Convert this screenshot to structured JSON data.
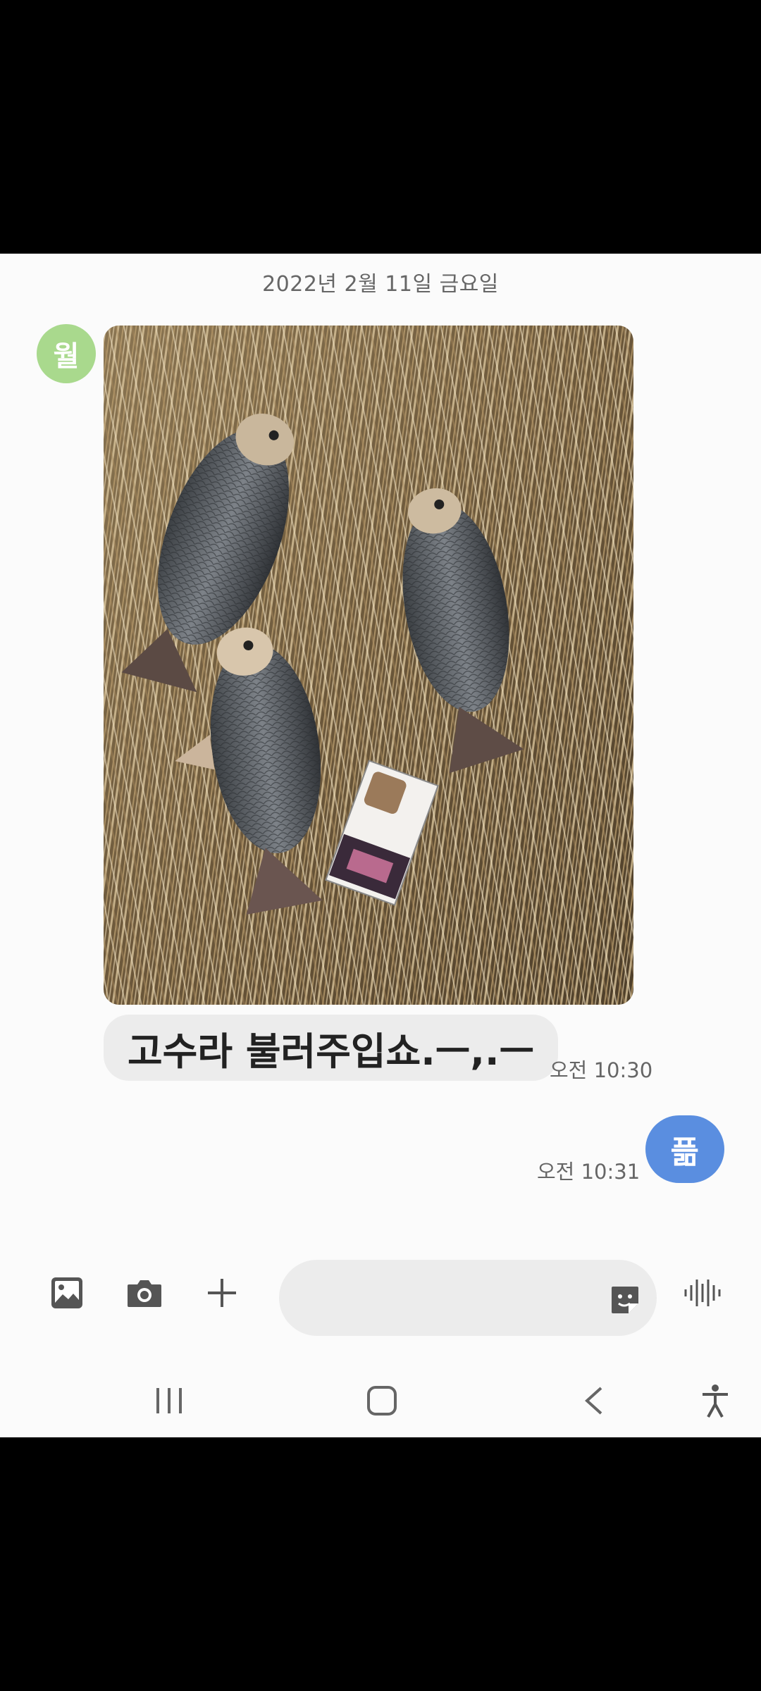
{
  "conversation": {
    "date_header": "2022년 2월 11일 금요일",
    "contact_avatar_initial": "월",
    "incoming": {
      "text": "고수라 불러주입쇼.ㅡ,.ㅡ",
      "time": "오전 10:30"
    },
    "outgoing": {
      "text": "픎",
      "time": "오전 10:31"
    }
  },
  "composer": {
    "placeholder": "",
    "icons": [
      "gallery-icon",
      "camera-icon",
      "plus-icon",
      "sticker-icon",
      "voice-icon"
    ]
  },
  "navbar": {
    "icons": [
      "recent-apps-icon",
      "home-icon",
      "back-icon",
      "accessibility-icon"
    ]
  },
  "colors": {
    "avatar": "#a9d98d",
    "outgoing_bubble": "#5a8ee0",
    "incoming_bubble": "#ececec"
  }
}
